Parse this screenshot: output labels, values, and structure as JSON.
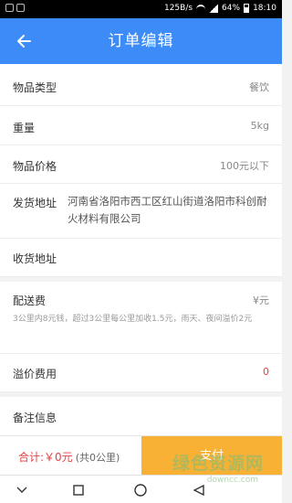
{
  "status_bar": {
    "speed": "125B/s",
    "battery": "64%",
    "time": "18:10"
  },
  "header": {
    "title": "订单编辑",
    "back_icon": "arrow-left-icon"
  },
  "form": {
    "category": {
      "label": "物品类型",
      "value": "餐饮"
    },
    "weight": {
      "label": "重量",
      "value": "5kg"
    },
    "price": {
      "label": "物品价格",
      "value": "100元以下"
    },
    "ship_address": {
      "label": "发货地址",
      "value": "河南省洛阳市西工区红山街道洛阳市科创耐火材料有限公司"
    },
    "receive_address": {
      "label": "收货地址",
      "value": ""
    },
    "delivery_fee": {
      "label": "配送费",
      "value": "¥元",
      "note": "3公里内8元钱，超过3公里每公里加收1.5元，雨天、夜间溢价2元"
    },
    "premium_fee": {
      "label": "溢价费用",
      "value": "0"
    },
    "remarks": {
      "label": "备注信息"
    }
  },
  "footer": {
    "total": "合计:￥0元",
    "distance": "(共0公里)",
    "pay_label": "支付"
  },
  "watermark": {
    "text": "绿色资源网",
    "url": "downcc.com"
  },
  "colors": {
    "header": "#3d8bf7",
    "pay_button": "#f8b135",
    "price_red": "#e84040"
  }
}
